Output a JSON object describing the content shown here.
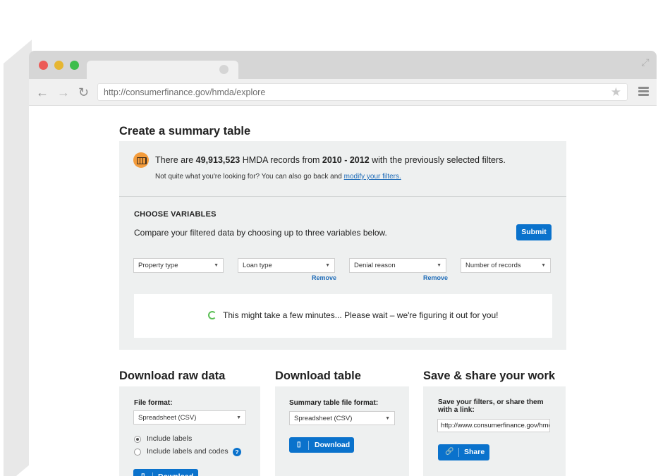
{
  "browser": {
    "url": "http://consumerfinance.gov/hmda/explore",
    "icons": [
      "back-arrow-icon",
      "forward-arrow-icon",
      "reload-icon",
      "star-icon",
      "menu-icon",
      "expand-icon"
    ]
  },
  "summary": {
    "title": "Create a summary table",
    "records_prefix": "There are ",
    "records_count": "49,913,523",
    "records_middle": " HMDA records from ",
    "records_range": "2010 - 2012",
    "records_suffix": " with the previously selected filters.",
    "subtext": "Not quite what you're looking for? You can also go back and ",
    "subtext_link": "modify your filters.",
    "choose_title": "CHOOSE VARIABLES",
    "compare_text": "Compare your filtered data by choosing up to three variables below.",
    "submit_label": "Submit",
    "variables": [
      {
        "value": "Property type",
        "remove": ""
      },
      {
        "value": "Loan type",
        "remove": "Remove"
      },
      {
        "value": "Denial reason",
        "remove": "Remove"
      },
      {
        "value": "Number of records",
        "remove": ""
      }
    ],
    "wait_text": "This might take a few minutes... Please wait – we're figuring it out for you!"
  },
  "raw": {
    "title": "Download raw data",
    "format_label": "File format:",
    "format_value": "Spreadsheet (CSV)",
    "options": [
      "Include labels",
      "Include labels and codes"
    ],
    "selected_option": "Include labels",
    "help": "?",
    "download_label": "Download"
  },
  "table": {
    "title": "Download table",
    "format_label": "Summary table file format:",
    "format_value": "Spreadsheet (CSV)",
    "download_label": "Download"
  },
  "share": {
    "title": "Save & share your work",
    "label_line1": "Save your filters, or share them",
    "label_line2": "with a link:",
    "link_value": "http://www.consumerfinance.gov/hmda/explore",
    "share_label": "Share"
  },
  "colors": {
    "accent_blue": "#0a72cc",
    "panel_gray": "#eef0f0",
    "records_icon_orange": "#f39c3c"
  }
}
